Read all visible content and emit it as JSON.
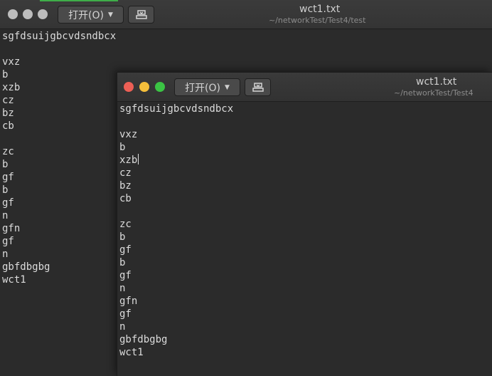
{
  "back_window": {
    "title": "wct1.txt",
    "path": "~/networkTest/Test4/test",
    "open_button_label": "打开(O)",
    "dropdown_icon": "caret-down-icon",
    "save_icon": "save-to-disk-icon",
    "lines": [
      "sgfdsuijgbcvdsndbcx",
      "",
      "vxz",
      "b",
      "xzb",
      "cz",
      "bz",
      "cb",
      "",
      "zc",
      "b",
      "gf",
      "b",
      "gf",
      "n",
      "gfn",
      "gf",
      "n",
      "gbfdbgbg",
      "wct1"
    ]
  },
  "front_window": {
    "title": "wct1.txt",
    "path": "~/networkTest/Test4",
    "open_button_label": "打开(O)",
    "dropdown_icon": "caret-down-icon",
    "save_icon": "save-to-disk-icon",
    "lines": [
      "sgfdsuijgbcvdsndbcx",
      "",
      "vxz",
      "b",
      "xzb",
      "cz",
      "bz",
      "cb",
      "",
      "zc",
      "b",
      "gf",
      "b",
      "gf",
      "n",
      "gfn",
      "gf",
      "n",
      "gbfdbgbg",
      "wct1"
    ]
  },
  "colors": {
    "close": "#ed5f55",
    "minimize": "#f5bf3b",
    "maximize": "#3bc444",
    "inactive_button": "#bdbdbd",
    "background": "#2b2b2b",
    "text": "#dcdcdc",
    "accent": "#3fae49"
  }
}
